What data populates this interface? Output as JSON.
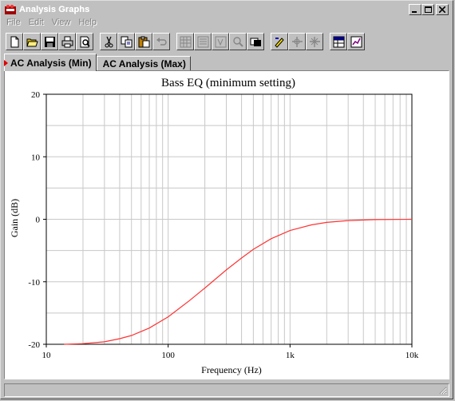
{
  "window": {
    "title": "Analysis Graphs",
    "buttons": {
      "minimize": "_",
      "maximize": "□",
      "close": "×"
    }
  },
  "menu": [
    {
      "label": "File"
    },
    {
      "label": "Edit"
    },
    {
      "label": "View"
    },
    {
      "label": "Help"
    }
  ],
  "toolbar": {
    "icons": [
      "new-icon",
      "open-icon",
      "save-icon",
      "print-icon",
      "print-preview-icon",
      "cut-icon",
      "copy-icon",
      "paste-icon",
      "undo-icon",
      "grid-icon",
      "legend-icon",
      "ruler-icon",
      "zoom-icon",
      "overlay-icon",
      "properties-icon",
      "cursor-icon",
      "export-icon",
      "table-icon",
      "chart-export-icon"
    ]
  },
  "tabs": [
    {
      "label": "AC Analysis (Min)",
      "active": true
    },
    {
      "label": "AC Analysis (Max)",
      "active": false
    }
  ],
  "colors": {
    "curve": "#ff3333",
    "grid": "#c8c8c8",
    "tab_marker": "#e00000"
  },
  "chart_data": {
    "type": "line",
    "title": "Bass EQ (minimum setting)",
    "xlabel": "Frequency (Hz)",
    "ylabel": "Gain (dB)",
    "xscale": "log",
    "xlim": [
      10,
      10000
    ],
    "ylim": [
      -20,
      20
    ],
    "xticks": [
      10,
      100,
      1000,
      10000
    ],
    "xtick_labels": [
      "10",
      "100",
      "1k",
      "10k"
    ],
    "yticks": [
      20,
      10,
      0,
      -10,
      -20
    ],
    "ytick_labels": [
      "20",
      "10",
      "0",
      "-10",
      "-20"
    ],
    "grid": true,
    "series": [
      {
        "x": [
          14,
          20,
          30,
          40,
          50,
          70,
          100,
          150,
          200,
          300,
          400,
          500,
          700,
          1000,
          1500,
          2000,
          3000,
          5000,
          10000
        ],
        "y": [
          -20,
          -19.9,
          -19.6,
          -19.1,
          -18.6,
          -17.4,
          -15.6,
          -13.0,
          -11.0,
          -8.1,
          -6.2,
          -4.8,
          -3.1,
          -1.8,
          -0.9,
          -0.5,
          -0.2,
          -0.05,
          0
        ]
      }
    ]
  }
}
